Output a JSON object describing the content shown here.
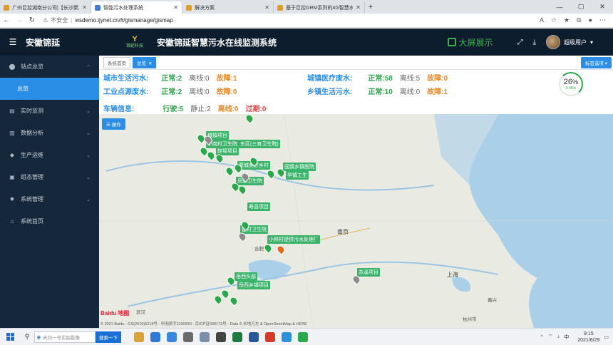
{
  "browser": {
    "tabs": [
      {
        "title": "广州巨控湖南分公司|【长沙聚控…"
      },
      {
        "title": "智能污水处理系统"
      },
      {
        "title": "解决方案"
      },
      {
        "title": "基于巨控GRM系列的4G智慧水利…"
      }
    ],
    "security": "不安全",
    "url": "wsdemo.ijynet.cn/#/gismanage/gismap"
  },
  "header": {
    "brand": "安徽锦延",
    "logo_text": "锦延科技",
    "logo_mark": "Y",
    "title": "安徽锦延智慧污水在线监测系统",
    "bigscreen": "大屏展示",
    "user": "超级用户"
  },
  "sidebar": {
    "items": [
      {
        "label": "站点总览",
        "icon": "location-pin-icon"
      },
      {
        "label": "实时监测",
        "icon": "monitor-icon"
      },
      {
        "label": "数据分析",
        "icon": "bar-chart-icon"
      },
      {
        "label": "生产运维",
        "icon": "android-icon"
      },
      {
        "label": "组态管理",
        "icon": "image-icon"
      },
      {
        "label": "系统管理",
        "icon": "gear-icon"
      },
      {
        "label": "系统首页",
        "icon": "home-icon"
      }
    ],
    "sub_active": "总览"
  },
  "main": {
    "tabs": [
      {
        "label": "系统首页"
      },
      {
        "label": "总览"
      }
    ],
    "options_button": "标签选项",
    "stats": {
      "city_domestic": {
        "label": "城市生活污水:",
        "normal": "正常:2",
        "offline": "离线:0",
        "fault": "故障:1"
      },
      "industrial": {
        "label": "工业点源废水:",
        "normal": "正常:2",
        "offline": "离线:0",
        "fault": "故障:0"
      },
      "town_medical": {
        "label": "城镇医疗废水:",
        "normal": "正常:58",
        "offline": "离线:5",
        "fault": "故障:0"
      },
      "town_domestic": {
        "label": "乡镇生活污水:",
        "normal": "正常:10",
        "offline": "离线:0",
        "fault": "故障:1"
      },
      "vehicle": {
        "label": "车辆信息:",
        "driving": "行驶:5",
        "stopped": "静止:2",
        "offline": "离线:0",
        "expired": "过期:0"
      }
    },
    "gauge": {
      "percent": "26",
      "unit": "%",
      "speed": "0.4K/s",
      "level": 0.26
    },
    "map": {
      "operate_button": "操作",
      "labels": [
        "城镇项目",
        "小岗村卫生院",
        "蚌埠项目",
        "东区(三官卫生院)",
        "国镇乡镇医院",
        "华镇工生",
        "凤集卫生院",
        "寿县项目",
        "楚村卫生院",
        "小林村提供污水处理厂",
        "岳西头部",
        "岳西乡镇项目",
        "蒙城美好乡村",
        "苏溪项目"
      ],
      "cities": [
        "南京",
        "上海",
        "合肥",
        "武汉",
        "杭州市",
        "嘉兴"
      ],
      "brand": "Baidu",
      "brand_cn": "地图",
      "copyright": "© 2021 Baidu - GS(2019)5218号 - 甲测资字1100930 - 京ICP证030173号 - Data © 长地万方 & OpenStreetMap & HERE"
    }
  },
  "taskbar": {
    "search_placeholder": "天问一号实拍影像",
    "search_button": "搜索一下",
    "time": "9:15",
    "date": "2021/6/29",
    "ime": "中"
  }
}
